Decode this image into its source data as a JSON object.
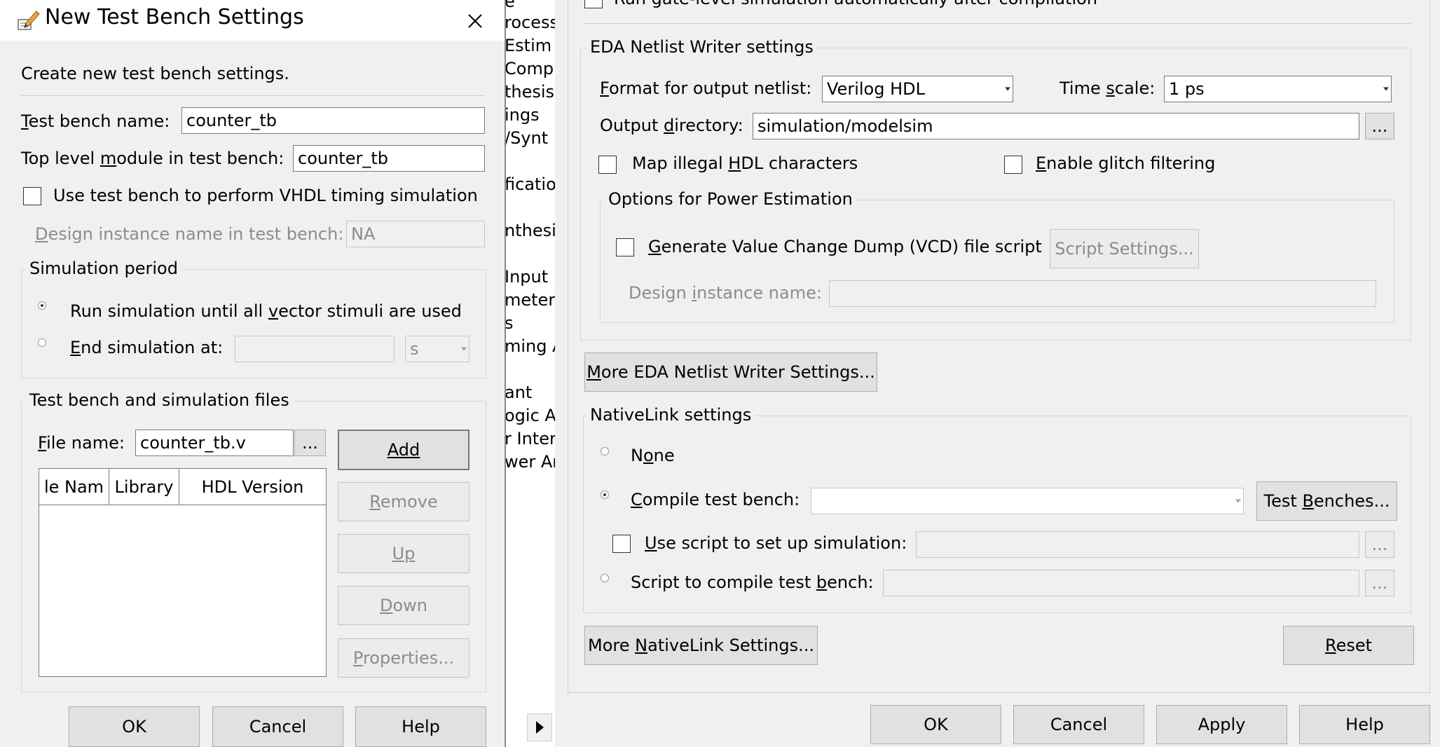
{
  "left_dialog": {
    "title": "New Test Bench Settings",
    "description": "Create new test bench settings.",
    "test_bench_name_label": "Test bench name:",
    "test_bench_name_value": "counter_tb",
    "top_level_label": "Top level module in test bench:",
    "top_level_value": "counter_tb",
    "vhdl_timing_label": "Use test bench to perform VHDL timing simulation",
    "design_instance_label": "Design instance name in test bench:",
    "design_instance_value": "NA",
    "simulation_period": {
      "title": "Simulation period",
      "run_all_label": "Run simulation until all vector stimuli are used",
      "end_at_label": "End simulation at:",
      "end_at_value": "",
      "unit_value": "s"
    },
    "files": {
      "title": "Test bench and simulation files",
      "file_name_label": "File name:",
      "file_name_value": "counter_tb.v",
      "browse_label": "...",
      "columns": [
        "le Nam",
        "Library",
        "HDL Version"
      ],
      "add_label": "Add",
      "remove_label": "Remove",
      "up_label": "Up",
      "down_label": "Down",
      "properties_label": "Properties..."
    },
    "ok_label": "OK",
    "cancel_label": "Cancel",
    "help_label": "Help"
  },
  "middle_list": {
    "items": [
      "e",
      "rocess",
      "Estim",
      "Comp",
      "thesis",
      "ings",
      "/Synt",
      "fication",
      "nthesis",
      "Input",
      "meter",
      "s",
      "ming A",
      "ant",
      "ogic A",
      "r Inter",
      "wer An"
    ]
  },
  "right_panel": {
    "top_cut_text": "Run gate-level simulation automatically after compilation",
    "eda": {
      "title": "EDA Netlist Writer settings",
      "format_label": "Format for output netlist:",
      "format_value": "Verilog HDL",
      "time_scale_label": "Time scale:",
      "time_scale_value": "1 ps",
      "output_dir_label": "Output directory:",
      "output_dir_value": "simulation/modelsim",
      "browse_label": "...",
      "map_illegal_label": "Map illegal HDL characters",
      "glitch_label": "Enable glitch filtering",
      "power": {
        "title": "Options for Power Estimation",
        "vcd_label": "Generate Value Change Dump (VCD) file script",
        "script_settings_label": "Script Settings...",
        "design_instance_label": "Design instance name:",
        "design_instance_value": ""
      }
    },
    "more_eda_label": "More EDA Netlist Writer Settings...",
    "nativelink": {
      "title": "NativeLink settings",
      "none_label": "None",
      "compile_label": "Compile test bench:",
      "compile_value": "",
      "test_benches_label": "Test Benches...",
      "use_script_label": "Use script to set up simulation:",
      "use_script_value": "",
      "script_compile_label": "Script to compile test bench:",
      "script_compile_value": "",
      "browse_label": "..."
    },
    "more_nativelink_label": "More NativeLink Settings...",
    "reset_label": "Reset",
    "ok_label": "OK",
    "cancel_label": "Cancel",
    "apply_label": "Apply",
    "help_label": "Help"
  }
}
